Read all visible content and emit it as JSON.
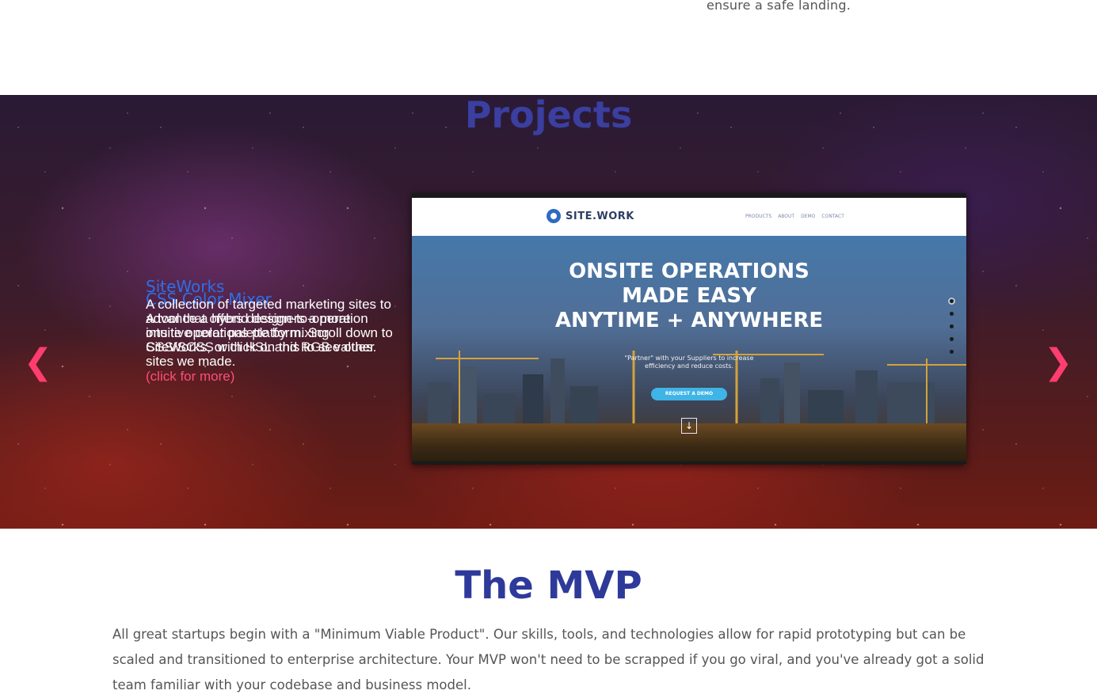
{
  "top_fragment": "ensure a safe landing.",
  "projects": {
    "title": "Projects",
    "prev_arrow": "❮",
    "next_arrow": "❯",
    "slides_overlapping": [
      {
        "title": "SiteWorks",
        "description": "A collection of targeted marketing sites to advance a hybrid design-to-operation onsite operations platform. Scroll down to SiteWorks, or click on this to see other sites we made."
      },
      {
        "title": "CSS Color Mixer",
        "description": "A tool that offers designers a more intuitive color palette by mixing CSS/SCSS with HSL and RGB values."
      }
    ],
    "click_more": "(click for more)",
    "screenshot": {
      "logo": "SITE.WORK",
      "nav": [
        "PRODUCTS",
        "ABOUT",
        "DEMO",
        "CONTACT"
      ],
      "hero_lines": [
        "ONSITE OPERATIONS",
        "MADE EASY",
        "ANYTIME + ANYWHERE"
      ],
      "hero_sub": [
        "\"Partner\" with your Suppliers to increase",
        "efficiency and reduce costs."
      ],
      "cta": "REQUEST A DEMO",
      "down_icon": "↓"
    },
    "colors": {
      "title": "#3a3fa0",
      "arrows": "#ff3d6e",
      "slide_title": "#2f6ee6",
      "click_more": "#ff4d7a"
    }
  },
  "mvp": {
    "title": "The MVP",
    "body": "All great startups begin with a \"Minimum Viable Product\". Our skills, tools, and technologies allow for rapid prototyping but can be scaled and transitioned to enterprise architecture. Your MVP won't need to be scrapped if you go viral, and you've already got a solid team familiar with your codebase and business model."
  }
}
